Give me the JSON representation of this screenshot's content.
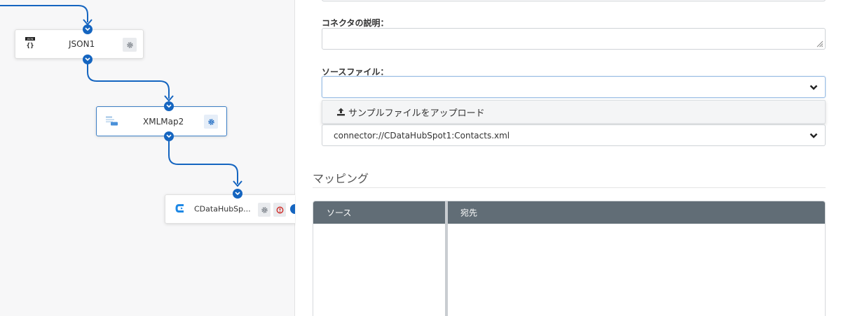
{
  "canvas": {
    "nodes": [
      {
        "id": "json1",
        "label": "JSON1",
        "icon": "json-icon"
      },
      {
        "id": "xmlmap2",
        "label": "XMLMap2",
        "icon": "xmlmap-icon",
        "selected": true
      },
      {
        "id": "cdatahubspot",
        "label": "CDataHubSp...",
        "icon": "cdata-icon",
        "status": "error"
      }
    ]
  },
  "panel": {
    "connector_description_label": "コネクタの説明：",
    "connector_description_value": "",
    "source_file_label": "ソースファイル：",
    "source_file_value": "",
    "upload_option_label": "サンプルファイルをアップロード",
    "destination_file_value": "connector://CDataHubSpot1:Contacts.xml",
    "mapping_title": "マッピング",
    "mapping_table": {
      "columns": [
        "ソース",
        "宛先"
      ]
    }
  },
  "colors": {
    "accent": "#1565c0",
    "table_header": "#616d76",
    "error": "#d0312d"
  }
}
